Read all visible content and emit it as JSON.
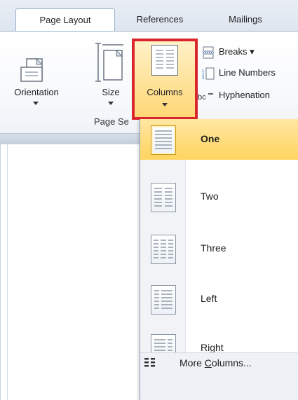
{
  "tabs": [
    {
      "label": "Page Layout",
      "active": true
    },
    {
      "label": "References",
      "active": false
    },
    {
      "label": "Mailings",
      "active": false
    }
  ],
  "ribbon": {
    "orientation_label": "Orientation",
    "size_label": "Size",
    "columns_label": "Columns",
    "breaks_label": "Breaks ▾",
    "line_numbers_label": "Line Numbers",
    "hyphenation_label": "Hyphenation",
    "group_label": "Page Se"
  },
  "columns_menu": {
    "items": [
      {
        "label": "One",
        "icon": "one-column-icon",
        "selected": true
      },
      {
        "label": "Two",
        "icon": "two-columns-icon",
        "selected": false
      },
      {
        "label": "Three",
        "icon": "three-columns-icon",
        "selected": false
      },
      {
        "label": "Left",
        "icon": "left-column-icon",
        "selected": false
      },
      {
        "label": "Right",
        "icon": "right-column-icon",
        "selected": false
      }
    ],
    "more_label_prefix": "More ",
    "more_label_underlined": "C",
    "more_label_suffix": "olumns..."
  },
  "colors": {
    "highlight_border": "#d9262c",
    "selected_fill": "#ffd45f",
    "menu_strip": "#f1f3f6"
  }
}
